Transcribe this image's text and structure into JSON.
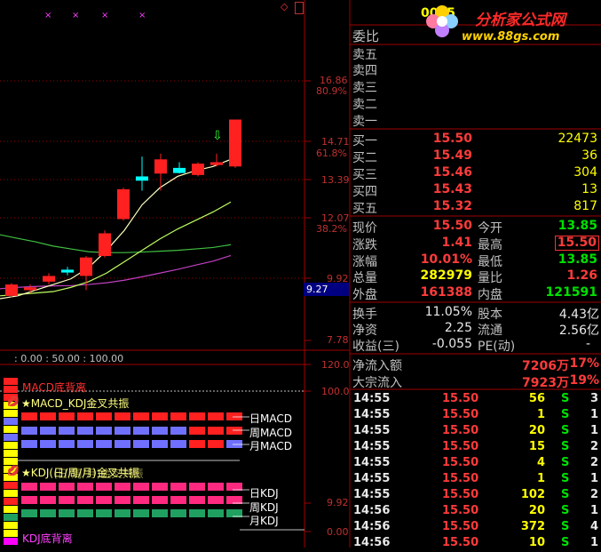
{
  "header": {
    "code": "0005"
  },
  "watermark": {
    "brand": "分析家公式网",
    "url": "www.88gs.com",
    "colors": {
      "brand": "#ff2a2a",
      "url": "#ffd200"
    }
  },
  "main_chart": {
    "price_ticks": [
      "16.86",
      "14.71",
      "13.39",
      "12.07",
      "9.92",
      "7.78"
    ],
    "pct_ticks": [
      "80.9%",
      "61.8%",
      "38.2%"
    ],
    "cursor_price": "9.27",
    "colors": {
      "up": "#ff2020",
      "down_doji": "#00ffff",
      "ma5": "#ffffc0",
      "ma10": "#c0ff60",
      "ma20": "#40c040",
      "ma60": "#c040c0",
      "grid": "#a00000"
    },
    "candles": [
      {
        "o": 9.3,
        "c": 9.7,
        "h": 9.75,
        "l": 9.25,
        "kind": "up"
      },
      {
        "o": 9.5,
        "c": 9.6,
        "h": 9.7,
        "l": 9.4,
        "kind": "up"
      },
      {
        "o": 9.8,
        "c": 10.0,
        "h": 10.1,
        "l": 9.7,
        "kind": "up"
      },
      {
        "o": 10.22,
        "c": 10.12,
        "h": 10.32,
        "l": 10.02,
        "kind": "doji"
      },
      {
        "o": 10.0,
        "c": 10.65,
        "h": 10.7,
        "l": 9.5,
        "kind": "up"
      },
      {
        "o": 10.7,
        "c": 11.5,
        "h": 11.6,
        "l": 10.65,
        "kind": "up"
      },
      {
        "o": 12.0,
        "c": 13.05,
        "h": 13.1,
        "l": 11.95,
        "kind": "up"
      },
      {
        "o": 13.5,
        "c": 13.35,
        "h": 14.2,
        "l": 13.0,
        "kind": "doji"
      },
      {
        "o": 13.6,
        "c": 14.1,
        "h": 14.3,
        "l": 13.0,
        "kind": "up"
      },
      {
        "o": 13.8,
        "c": 13.62,
        "h": 14.0,
        "l": 13.6,
        "kind": "doji"
      },
      {
        "o": 13.55,
        "c": 13.95,
        "h": 14.0,
        "l": 13.5,
        "kind": "up"
      },
      {
        "o": 13.9,
        "c": 14.0,
        "h": 14.3,
        "l": 13.85,
        "kind": "up"
      },
      {
        "o": 13.85,
        "c": 15.5,
        "h": 15.5,
        "l": 13.8,
        "kind": "up"
      }
    ],
    "ma5": [
      9.2,
      9.3,
      9.5,
      9.7,
      9.9,
      10.3,
      10.9,
      11.6,
      12.5,
      13.1,
      13.5,
      13.7,
      13.85,
      14.1
    ],
    "ma10": [
      9.3,
      9.35,
      9.4,
      9.45,
      9.6,
      9.8,
      10.1,
      10.5,
      10.9,
      11.3,
      11.65,
      11.95,
      12.25,
      12.6
    ],
    "ma20": [
      11.45,
      11.32,
      11.2,
      11.05,
      10.95,
      10.85,
      10.82,
      10.82,
      10.84,
      10.87,
      10.9,
      10.95,
      11.0,
      11.1
    ],
    "ma60": [
      9.55,
      9.6,
      9.63,
      9.65,
      9.66,
      9.7,
      9.76,
      9.85,
      9.97,
      10.1,
      10.23,
      10.38,
      10.52,
      10.72
    ],
    "top_markers": [
      "×",
      "×",
      "×",
      "×"
    ],
    "arrow_marker": "⇩",
    "corner_glyph": "◇"
  },
  "sub_chart": {
    "params": ": 0.00 : 50.00 : 100.00",
    "ticks": [
      "120.0",
      "100.0",
      "9.92",
      "0.00"
    ],
    "labels": {
      "macd_div": "MACD底背离",
      "macd_kdj": "★MACD_KDJ金叉共振",
      "kdj_title": "★KDJ(日/周/月)金叉共振",
      "kdj_title_overlap": "(日/周/月)金叉共振",
      "kdj_div": "KDJ底背离",
      "rows_macd": [
        "日MACD",
        "周MACD",
        "月MACD"
      ],
      "rows_kdj": [
        "日KDJ",
        "周KDJ",
        "月KDJ"
      ]
    },
    "colors": {
      "red": "#ff2020",
      "blue": "#7070ff",
      "pink": "#ff2a80",
      "green": "#20a060",
      "yellow": "#ffff00",
      "magenta": "#ff00ff"
    }
  },
  "orderbook": {
    "ratio_label": "委比",
    "asks": [
      {
        "label": "卖五",
        "price": "",
        "vol": ""
      },
      {
        "label": "卖四",
        "price": "",
        "vol": ""
      },
      {
        "label": "卖三",
        "price": "",
        "vol": ""
      },
      {
        "label": "卖二",
        "price": "",
        "vol": ""
      },
      {
        "label": "卖一",
        "price": "",
        "vol": ""
      }
    ],
    "bids": [
      {
        "label": "买一",
        "price": "15.50",
        "vol": "22473"
      },
      {
        "label": "买二",
        "price": "15.49",
        "vol": "36"
      },
      {
        "label": "买三",
        "price": "15.46",
        "vol": "304"
      },
      {
        "label": "买四",
        "price": "15.43",
        "vol": "13"
      },
      {
        "label": "买五",
        "price": "15.32",
        "vol": "817"
      }
    ]
  },
  "quote": {
    "rows": [
      {
        "l1": "现价",
        "v1": "15.50",
        "l2": "今开",
        "v2": "13.85"
      },
      {
        "l1": "涨跌",
        "v1": "1.41",
        "l2": "最高",
        "v2": "15.50"
      },
      {
        "l1": "涨幅",
        "v1": "10.01%",
        "l2": "最低",
        "v2": "13.85"
      },
      {
        "l1": "总量",
        "v1": "282979",
        "l2": "量比",
        "v2": "1.26"
      },
      {
        "l1": "外盘",
        "v1": "161388",
        "l2": "内盘",
        "v2": "121591"
      }
    ]
  },
  "fundamentals": {
    "rows": [
      {
        "l1": "换手",
        "v1": "11.05%",
        "l2": "股本",
        "v2": "4.43亿"
      },
      {
        "l1": "净资",
        "v1": "2.25",
        "l2": "流通",
        "v2": "2.56亿"
      },
      {
        "l1": "收益(三)",
        "v1": "-0.055",
        "l2": "PE(动)",
        "v2": "-"
      }
    ]
  },
  "flow": {
    "rows": [
      {
        "label": "净流入额",
        "value": "7206万",
        "pct": "17%"
      },
      {
        "label": "大宗流入",
        "value": "7923万",
        "pct": "19%"
      }
    ]
  },
  "ticks": [
    {
      "time": "14:55",
      "price": "15.50",
      "vol": "56",
      "side": "S",
      "n": "3"
    },
    {
      "time": "14:55",
      "price": "15.50",
      "vol": "1",
      "side": "S",
      "n": "1"
    },
    {
      "time": "14:55",
      "price": "15.50",
      "vol": "20",
      "side": "S",
      "n": "1"
    },
    {
      "time": "14:55",
      "price": "15.50",
      "vol": "15",
      "side": "S",
      "n": "2"
    },
    {
      "time": "14:55",
      "price": "15.50",
      "vol": "4",
      "side": "S",
      "n": "2"
    },
    {
      "time": "14:55",
      "price": "15.50",
      "vol": "1",
      "side": "S",
      "n": "1"
    },
    {
      "time": "14:55",
      "price": "15.50",
      "vol": "102",
      "side": "S",
      "n": "2"
    },
    {
      "time": "14:56",
      "price": "15.50",
      "vol": "20",
      "side": "S",
      "n": "1"
    },
    {
      "time": "14:56",
      "price": "15.50",
      "vol": "372",
      "side": "S",
      "n": "4"
    },
    {
      "time": "14:56",
      "price": "15.50",
      "vol": "10",
      "side": "S",
      "n": "1"
    }
  ]
}
